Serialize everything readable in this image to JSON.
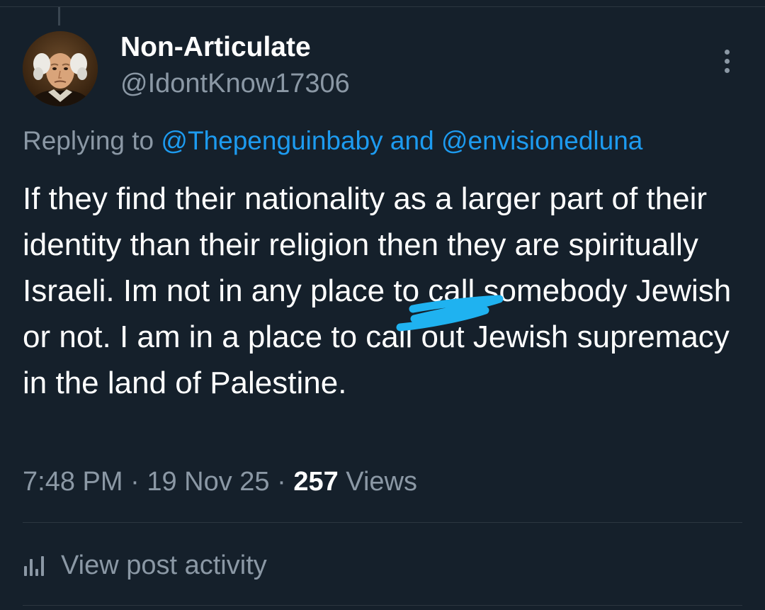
{
  "author": {
    "display_name": "Non-Articulate",
    "handle": "@IdontKnow17306"
  },
  "reply_context": {
    "prefix": "Replying to",
    "mention_1": "@Thepenguinbaby",
    "conjunction": "and",
    "mention_2": "@envisionedluna"
  },
  "post": {
    "text": "If they find their nationality as a larger part of their identity than their religion then they are spiritually Israeli. Im not in any place to call somebody Jewish or not. I am in a place to call out Jewish supremacy in the land of Palestine."
  },
  "meta": {
    "time": "7:48 PM",
    "sep_1": "·",
    "date": "19 Nov 25",
    "sep_2": "·",
    "views_count": "257",
    "views_label": "Views"
  },
  "actions": {
    "view_activity_label": "View post activity"
  },
  "icons": {
    "more": "more-vertical-icon",
    "activity": "bar-chart-icon"
  },
  "colors": {
    "background": "#15202b",
    "primary_text": "#ffffff",
    "secondary_text": "#8b98a5",
    "link": "#1d9bf0",
    "scribble": "#1fb2f0"
  }
}
